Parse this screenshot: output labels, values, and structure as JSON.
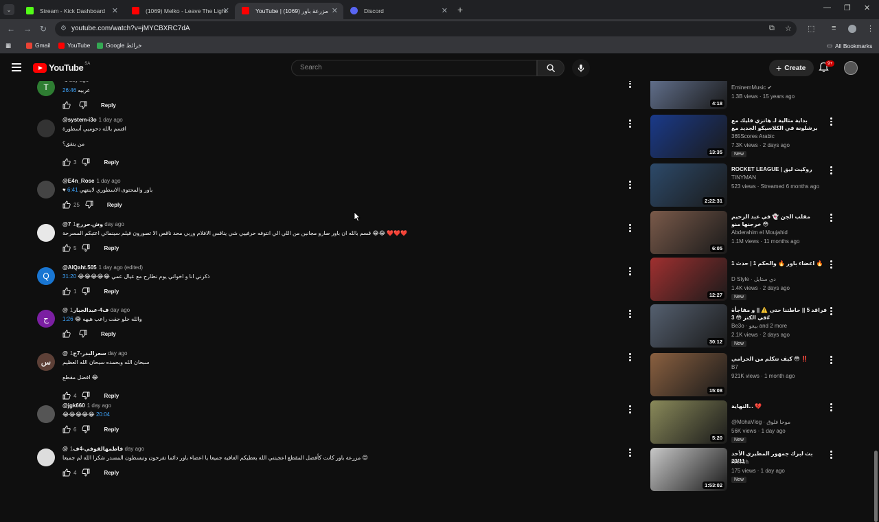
{
  "browser": {
    "tabs": [
      {
        "title": "Stream - Kick Dashboard",
        "color": "#53fc18",
        "active": false
      },
      {
        "title": "(1069) Melko - Leave The Light",
        "color": "#ff0000",
        "active": false
      },
      {
        "title": "YouTube | مزرعة باور (1069)",
        "color": "#ff0000",
        "active": true
      },
      {
        "title": "Discord",
        "color": "#5865f2",
        "active": false
      }
    ],
    "url": "youtube.com/watch?v=jMYCBXRC7dA",
    "bookmarks": [
      {
        "label": "Gmail",
        "color": "#ea4335"
      },
      {
        "label": "YouTube",
        "color": "#ff0000"
      },
      {
        "label": "Google خرائط",
        "color": "#34a853"
      }
    ],
    "all_bookmarks": "All Bookmarks"
  },
  "header": {
    "logo_text": "YouTube",
    "country_code": "SA",
    "search_placeholder": "Search",
    "create_label": "Create",
    "notif_count": "9+"
  },
  "comments": [
    {
      "handle": "",
      "date": "1 day ago",
      "text": "عربيه",
      "ts": "26:46",
      "likes": "",
      "avatar_letter": "T",
      "avatar_color": "#2e7d32"
    },
    {
      "handle": "@system-i3o",
      "date": "1 day ago",
      "text": "اقسم بالله دحوميي أسطورة",
      "text2": "من يتفق؟",
      "ts": "",
      "likes": "3",
      "avatar_letter": "",
      "avatar_color": "#333"
    },
    {
      "handle": "@E4n_Rose",
      "date": "1 day ago",
      "text": "♥ باور والمحتوى الاسطوري لاينتهي",
      "ts": "6:41",
      "likes": "25",
      "avatar_letter": "",
      "avatar_color": "#444"
    },
    {
      "handle": "@وش.حررج7",
      "date": "1 day ago",
      "text": "قسم بالله ان باور صارو مجانين من اللي الي انتوفه حرفييي شي يناقس الافلام وربي محد ناقص الا تصورون فيلم سينمائي اعتبكم المسرحة 😂😂 ❤️❤️❤️",
      "ts": "",
      "likes": "5",
      "avatar_letter": "",
      "avatar_color": "#e8e8e8"
    },
    {
      "handle": "@AlQaht.505",
      "date": "1 day ago (edited)",
      "text": "ذكرني انا و اخواني يوم نطارح مع عيال عمي 😂😂😂😂😂",
      "ts": "31:20",
      "likes": "1",
      "avatar_letter": "Q",
      "avatar_color": "#1976d2"
    },
    {
      "handle": "@ف4-عبدالجبار",
      "date": "1 day ago",
      "text": "والله حلو حفت راعب هيهه 😂",
      "ts": "1:26",
      "likes": "",
      "avatar_letter": "ج",
      "avatar_color": "#7b1fa2"
    },
    {
      "handle": "@سعرالبدر-7ج",
      "date": "1 day ago",
      "text": "سبحان الله وبحمده سبحان الله العظيم",
      "text2": "افضل مقطع 😂",
      "ts": "",
      "likes": "4",
      "avatar_letter": "س",
      "avatar_color": "#5d4037"
    },
    {
      "handle": "@jgk660",
      "date": "1 day ago",
      "text": "😂😂😂😂😂",
      "ts": "20:04",
      "likes": "6",
      "avatar_letter": "",
      "avatar_color": "#555"
    },
    {
      "handle": "@فاطمهالقوفي-4ف",
      "date": "1 day ago",
      "text": "مزرعة باور كانت كأفضل المقطع اعجبتني الله يعطيكم العافيه جميعا يا اعضاء باور دائما تفرحون وتبسطون المسدر شكرا الله لم جميعا 😊",
      "ts": "",
      "likes": "4",
      "avatar_letter": "",
      "avatar_color": "#ddd"
    }
  ],
  "comment_labels": {
    "reply": "Reply"
  },
  "videos": [
    {
      "title": "Music Video)",
      "channel": "EminemMusic ✔",
      "meta": "1.3B views · 15 years ago",
      "duration": "4:18",
      "new": "",
      "thumb": "#6a7a9a"
    },
    {
      "title": "بداية مثالية لـ هانزي فليك مع برشلونة في الكلاسيكو الجديد مع عودة جارسيا ورافينيا وتألق ليروين",
      "channel": "365Scores Arabic",
      "meta": "7.3K views · 2 days ago",
      "duration": "13:35",
      "new": "New",
      "thumb": "#1a3a8a"
    },
    {
      "title": "ROCKET LEAGUE | روكيت ليق",
      "channel": "TINYMAN",
      "meta": "523 views · Streamed 6 months ago",
      "duration": "2:22:31",
      "new": "",
      "thumb": "#2d4a6a"
    },
    {
      "title": "مقلب الجن 👻 في عبد الرحيم خرجنها منو 😳",
      "channel": "Abderahim el Moujahid",
      "meta": "1.1M views · 11 months ago",
      "duration": "6:05",
      "new": "",
      "thumb": "#7a5a4a"
    },
    {
      "title": "اعضاء باور 🔥 والحكم 1 | حدث 1 🔥",
      "channel": "D Style · دي ستايل",
      "meta": "1.4K views · 2 days ago",
      "duration": "12:27",
      "new": "New",
      "thumb": "#a03030"
    },
    {
      "title": "فراقد 5 || حاطتنا حتى ⚠️ || و مفاجأة في الكنز 😳 3#",
      "channel": "Be3o · بيعو and 2 more",
      "meta": "2.1K views · 2 days ago",
      "duration": "30:12",
      "new": "New",
      "thumb": "#556070"
    },
    {
      "title": "كيف تتكلم من الحرامي 😳 ‼️",
      "channel": "B7",
      "meta": "921K views · 1 month ago",
      "duration": "15:08",
      "new": "",
      "thumb": "#8a6040"
    },
    {
      "title": "النهاية... 💔",
      "channel": "@MohaVlog · موحا فلوق",
      "meta": "56K views · 1 day ago",
      "duration": "5:20",
      "new": "New",
      "thumb": "#8a8a5a"
    },
    {
      "title": "بث لبرك جمهور المطيري الأحد 23/11",
      "channel": "Himtch",
      "meta": "175 views · 1 day ago",
      "duration": "1:53:02",
      "new": "New",
      "thumb": "#c8c8c8"
    }
  ]
}
